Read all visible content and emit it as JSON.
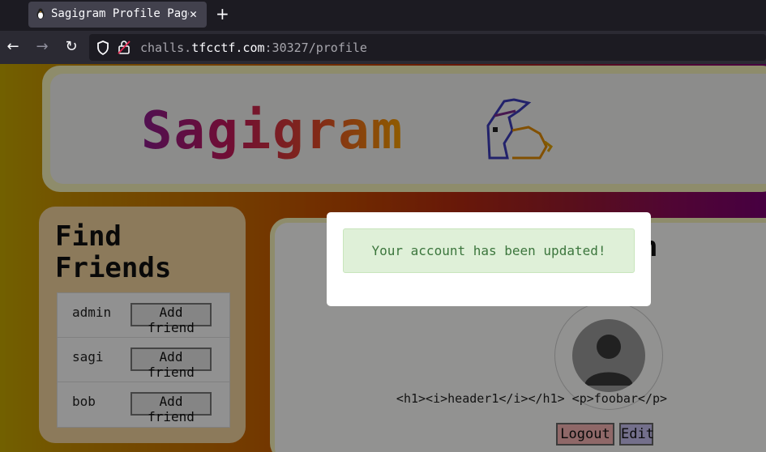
{
  "browser": {
    "tab_title": "Sagigram Profile Page",
    "url_host": "challs.",
    "url_domain": "tfcctf.com",
    "url_rest": ":30327/profile"
  },
  "header": {
    "logo_text": "Sagigram"
  },
  "friends": {
    "title_line1": "Find",
    "title_line2": "Friends",
    "items": [
      {
        "name": "admin",
        "button": "Add friend"
      },
      {
        "name": "sagi",
        "button": "Add friend"
      },
      {
        "name": "bob",
        "button": "Add friend"
      }
    ]
  },
  "profile": {
    "heading_fragment": "n",
    "bio": "<h1><i>header1</i></h1> <p>foobar</p>",
    "logout_label": "Logout",
    "edit_label": "Edit"
  },
  "modal": {
    "message": "Your account has been updated!"
  },
  "colors": {
    "alert_bg": "#dff0d8",
    "alert_text": "#3c763d",
    "logout_bg": "#f6b4b4",
    "edit_bg": "#c6c0f0"
  }
}
